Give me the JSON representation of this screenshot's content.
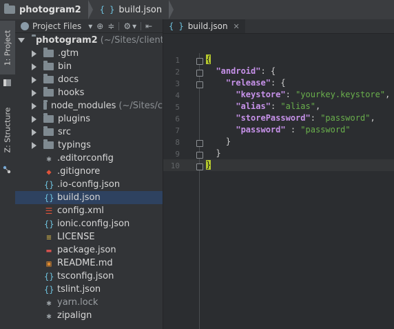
{
  "breadcrumb": {
    "project": "photogram2",
    "file": "build.json"
  },
  "toolstrip": {
    "project_tab": "1: Project",
    "structure_tab": "Z: Structure"
  },
  "project_panel": {
    "view_selector": "Project Files",
    "tree": [
      {
        "name": "photogram2",
        "extra": "(~/Sites/cliente",
        "kind": "root",
        "expanded": true,
        "icon": "folder-icon"
      },
      {
        "name": ".gtm",
        "kind": "dir",
        "icon": "folder-icon"
      },
      {
        "name": "bin",
        "kind": "dir",
        "icon": "folder-icon"
      },
      {
        "name": "docs",
        "kind": "dir",
        "icon": "folder-icon"
      },
      {
        "name": "hooks",
        "kind": "dir",
        "icon": "folder-icon"
      },
      {
        "name": "node_modules",
        "extra": "(~/Sites/c",
        "kind": "dir",
        "icon": "folder-icon"
      },
      {
        "name": "plugins",
        "kind": "dir",
        "icon": "folder-icon"
      },
      {
        "name": "src",
        "kind": "dir",
        "icon": "folder-icon"
      },
      {
        "name": "typings",
        "kind": "dir",
        "icon": "folder-icon"
      },
      {
        "name": ".editorconfig",
        "kind": "file",
        "icon": "asterisk-icon"
      },
      {
        "name": ".gitignore",
        "kind": "file",
        "icon": "git-icon"
      },
      {
        "name": ".io-config.json",
        "kind": "file",
        "icon": "json-icon"
      },
      {
        "name": "build.json",
        "kind": "file",
        "icon": "json-icon",
        "selected": true
      },
      {
        "name": "config.xml",
        "kind": "file",
        "icon": "xml-icon"
      },
      {
        "name": "ionic.config.json",
        "kind": "file",
        "icon": "json-icon"
      },
      {
        "name": "LICENSE",
        "kind": "file",
        "icon": "text-icon"
      },
      {
        "name": "package.json",
        "kind": "file",
        "icon": "npm-icon"
      },
      {
        "name": "README.md",
        "kind": "file",
        "icon": "markdown-icon"
      },
      {
        "name": "tsconfig.json",
        "kind": "file",
        "icon": "json-icon"
      },
      {
        "name": "tslint.json",
        "kind": "file",
        "icon": "json-icon"
      },
      {
        "name": "yarn.lock",
        "kind": "file",
        "icon": "asterisk-icon",
        "muted": true
      },
      {
        "name": "zipalign",
        "kind": "file",
        "icon": "asterisk-icon"
      }
    ]
  },
  "editor": {
    "tab_label": "build.json",
    "line_numbers": [
      "1",
      "2",
      "3",
      "4",
      "5",
      "6",
      "7",
      "8",
      "9",
      "10"
    ],
    "lines": {
      "l1": "{",
      "l2_key": "\"android\"",
      "l2_rest": ": {",
      "l3_key": "\"release\"",
      "l3_rest": ": {",
      "l4_key": "\"keystore\"",
      "l4_sep": ": ",
      "l4_val": "\"yourkey.keystore\"",
      "l4_end": ",",
      "l5_key": "\"alias\"",
      "l5_sep": ": ",
      "l5_val": "\"alias\"",
      "l5_end": ",",
      "l6_key": "\"storePassword\"",
      "l6_sep": ": ",
      "l6_val": "\"password\"",
      "l6_end": ",",
      "l7_key": "\"password\"",
      "l7_sep": " : ",
      "l7_val": "\"password\"",
      "l8": "}",
      "l9": "}",
      "l10": "}"
    }
  },
  "colors": {
    "keyword": "#c792ea",
    "string": "#6ab04c",
    "selection": "#2e4260",
    "brace_match": "#b5c82e"
  }
}
